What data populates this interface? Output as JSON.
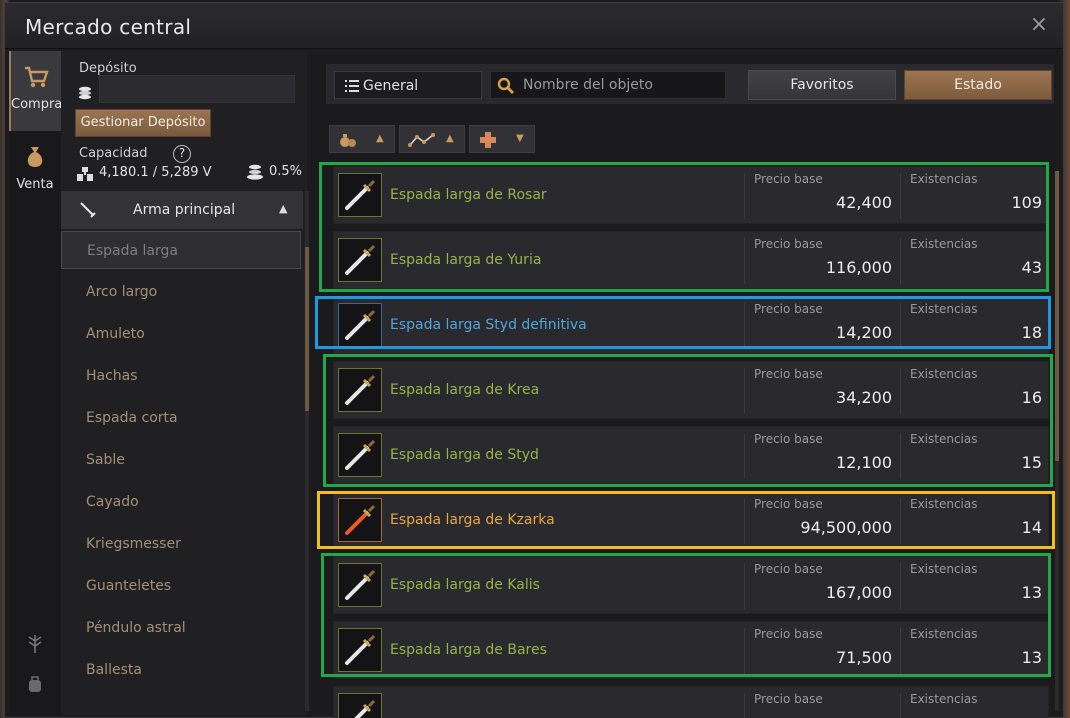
{
  "window": {
    "title": "Mercado central",
    "close_glyph": "×"
  },
  "tabs": [
    {
      "label": "Compra",
      "icon": "cart-icon",
      "active": true
    },
    {
      "label": "Venta",
      "icon": "money-bag-icon",
      "active": false
    }
  ],
  "deposit": {
    "label": "Depósito",
    "value": "",
    "manage_button": "Gestionar Depósito"
  },
  "capacity": {
    "label": "Capacidad",
    "help_glyph": "?",
    "value": "4,180.1 / 5,289 V",
    "tax": "0.5%"
  },
  "category": {
    "header": "Arma principal",
    "items": [
      "Espada larga",
      "Arco largo",
      "Amuleto",
      "Hachas",
      "Espada corta",
      "Sable",
      "Cayado",
      "Kriegsmesser",
      "Guanteletes",
      "Péndulo astral",
      "Ballesta"
    ],
    "active_index": 0
  },
  "toolbar": {
    "filter_label": "General",
    "search_placeholder": "Nombre del objeto",
    "favorites_button": "Favoritos",
    "status_button": "Estado"
  },
  "columns": {
    "price": "Precio base",
    "stock": "Existencias"
  },
  "items": [
    {
      "name": "Espada larga de Rosar",
      "price": "42,400",
      "stock": "109",
      "color": "#9ab04a",
      "grade": "green"
    },
    {
      "name": "Espada larga de Yuria",
      "price": "116,000",
      "stock": "43",
      "color": "#9ab04a",
      "grade": "green"
    },
    {
      "name": "Espada larga Styd definitiva",
      "price": "14,200",
      "stock": "18",
      "color": "#4fa6de",
      "grade": "blue"
    },
    {
      "name": "Espada larga de Krea",
      "price": "34,200",
      "stock": "16",
      "color": "#9ab04a",
      "grade": "green"
    },
    {
      "name": "Espada larga de Styd",
      "price": "12,100",
      "stock": "15",
      "color": "#9ab04a",
      "grade": "green"
    },
    {
      "name": "Espada larga de Kzarka",
      "price": "94,500,000",
      "stock": "14",
      "color": "#e8a640",
      "grade": "orange"
    },
    {
      "name": "Espada larga de Kalis",
      "price": "167,000",
      "stock": "13",
      "color": "#9ab04a",
      "grade": "green"
    },
    {
      "name": "Espada larga de Bares",
      "price": "71,500",
      "stock": "13",
      "color": "#9ab04a",
      "grade": "green"
    },
    {
      "name": "",
      "price": "",
      "stock": "",
      "color": "#9ab04a",
      "grade": "green"
    }
  ],
  "highlight_colors": {
    "green": "#22a74a",
    "blue": "#1f9ae0",
    "yellow": "#f4bf1a"
  }
}
